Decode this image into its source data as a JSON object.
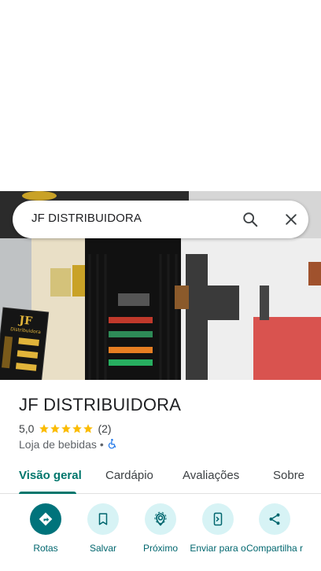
{
  "search": {
    "query": "JF DISTRIBUIDORA"
  },
  "place": {
    "name": "JF DISTRIBUIDORA",
    "rating": "5,0",
    "stars": 5,
    "review_count": "(2)",
    "category": "Loja de bebidas",
    "separator": "•"
  },
  "tabs": [
    {
      "label": "Visão geral",
      "active": true
    },
    {
      "label": "Cardápio",
      "active": false
    },
    {
      "label": "Avaliações",
      "active": false
    },
    {
      "label": "Sobre",
      "active": false
    }
  ],
  "actions": [
    {
      "label": "Rotas",
      "icon": "directions-icon"
    },
    {
      "label": "Salvar",
      "icon": "bookmark-icon"
    },
    {
      "label": "Próximo",
      "icon": "nearby-icon"
    },
    {
      "label": "Enviar para o",
      "icon": "send-to-phone-icon"
    },
    {
      "label": "Compartilha r",
      "icon": "share-icon"
    }
  ],
  "photo": {
    "sign_text": "JF",
    "sign_subtext": "Distribuidora"
  },
  "colors": {
    "accent": "#00766c",
    "primary_action": "#00737b",
    "action_bg": "#d7f3f5",
    "star": "#fbbc04",
    "accessibility": "#1a73e8"
  }
}
